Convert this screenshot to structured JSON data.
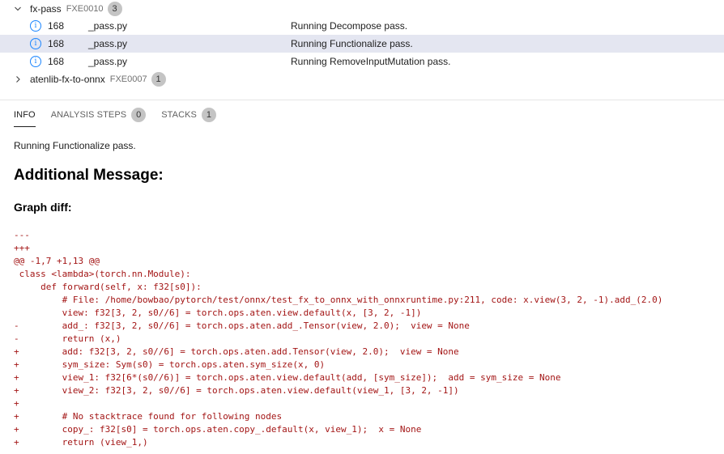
{
  "tree": {
    "groups": [
      {
        "name": "fx-pass",
        "code": "FXE0010",
        "count": "3",
        "expanded": true
      },
      {
        "name": "atenlib-fx-to-onnx",
        "code": "FXE0007",
        "count": "1",
        "expanded": false
      }
    ],
    "results": [
      {
        "line": "168",
        "file": "_pass.py",
        "message": "Running Decompose pass."
      },
      {
        "line": "168",
        "file": "_pass.py",
        "message": "Running Functionalize pass."
      },
      {
        "line": "168",
        "file": "_pass.py",
        "message": "Running RemoveInputMutation pass."
      }
    ]
  },
  "tabs": [
    {
      "label": "INFO",
      "count": null
    },
    {
      "label": "ANALYSIS STEPS",
      "count": "0"
    },
    {
      "label": "STACKS",
      "count": "1"
    }
  ],
  "info": {
    "message": "Running Functionalize pass.",
    "heading": "Additional Message:",
    "subheading": "Graph diff:",
    "diff_lines": [
      "---",
      "+++",
      "@@ -1,7 +1,13 @@",
      " class <lambda>(torch.nn.Module):",
      "     def forward(self, x: f32[s0]):",
      "         # File: /home/bowbao/pytorch/test/onnx/test_fx_to_onnx_with_onnxruntime.py:211, code: x.view(3, 2, -1).add_(2.0)",
      "         view: f32[3, 2, s0//6] = torch.ops.aten.view.default(x, [3, 2, -1])",
      "-        add_: f32[3, 2, s0//6] = torch.ops.aten.add_.Tensor(view, 2.0);  view = None",
      "-        return (x,)",
      "+        add: f32[3, 2, s0//6] = torch.ops.aten.add.Tensor(view, 2.0);  view = None",
      "+        sym_size: Sym(s0) = torch.ops.aten.sym_size(x, 0)",
      "+        view_1: f32[6*(s0//6)] = torch.ops.aten.view.default(add, [sym_size]);  add = sym_size = None",
      "+        view_2: f32[3, 2, s0//6] = torch.ops.aten.view.default(view_1, [3, 2, -1])",
      "+",
      "+        # No stacktrace found for following nodes",
      "+        copy_: f32[s0] = torch.ops.aten.copy_.default(x, view_1);  x = None",
      "+        return (view_1,)"
    ]
  },
  "colors": {
    "selected_row": "#e4e6f1",
    "info_icon": "#1a85ff",
    "diff_text": "#a31515",
    "badge": "#c4c4c4"
  },
  "icons": {
    "expanded": "chevron-down-icon",
    "collapsed": "chevron-right-icon",
    "result": "info-icon"
  }
}
